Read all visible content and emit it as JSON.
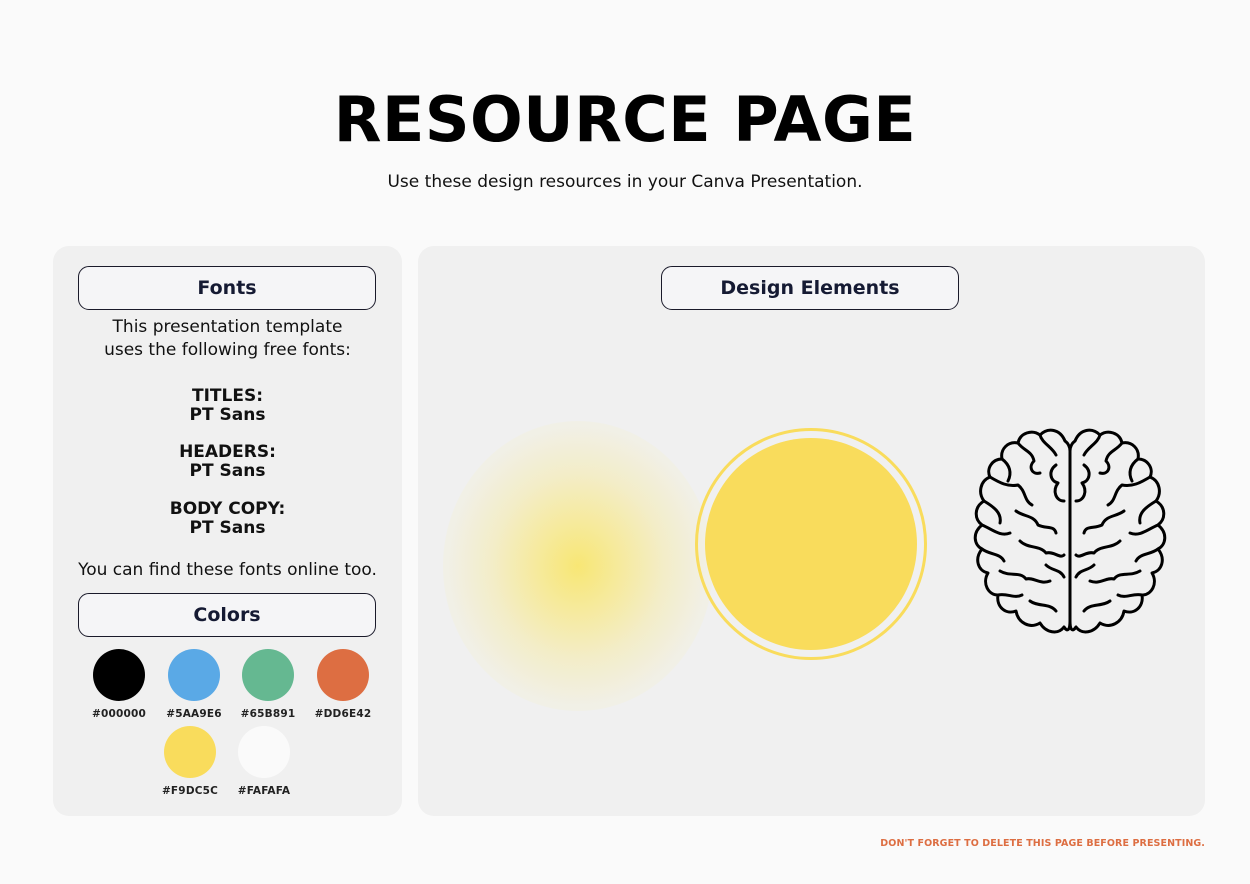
{
  "page": {
    "title": "RESOURCE PAGE",
    "subtitle": "Use these design resources in your Canva Presentation.",
    "footer_note": "DON'T FORGET TO DELETE THIS PAGE BEFORE PRESENTING."
  },
  "fonts_section": {
    "header": "Fonts",
    "intro_line1": "This presentation template",
    "intro_line2": "uses the following free fonts:",
    "entries": [
      {
        "label": "TITLES:",
        "font": "PT Sans"
      },
      {
        "label": "HEADERS:",
        "font": "PT Sans"
      },
      {
        "label": "BODY COPY:",
        "font": "PT Sans"
      }
    ],
    "outro": "You can find these fonts online too."
  },
  "colors_section": {
    "header": "Colors",
    "swatches": [
      {
        "code": "#000000",
        "color": "#000000"
      },
      {
        "code": "#5AA9E6",
        "color": "#5AA9E6"
      },
      {
        "code": "#65B891",
        "color": "#65B891"
      },
      {
        "code": "#DD6E42",
        "color": "#DD6E42"
      },
      {
        "code": "#F9DC5C",
        "color": "#F9DC5C"
      },
      {
        "code": "#FAFAFA",
        "color": "#FAFAFA"
      }
    ]
  },
  "design_section": {
    "header": "Design Elements",
    "elements": [
      {
        "name": "yellow-glow",
        "color": "#F9DC5C"
      },
      {
        "name": "yellow-sun-circle",
        "color": "#F9DC5C"
      },
      {
        "name": "brain-outline",
        "color": "#000000"
      }
    ]
  }
}
